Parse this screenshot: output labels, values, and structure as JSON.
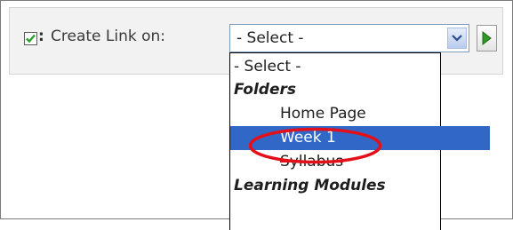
{
  "toolbar": {
    "checkbox_icon": "checkbox-checked-icon",
    "colon": ":",
    "label": "Create Link on:",
    "select_value": "- Select -",
    "arrow_icon": "chevron-down-icon",
    "go_icon": "play-arrow-icon"
  },
  "dropdown": {
    "options": [
      {
        "label": "- Select -",
        "kind": "option"
      },
      {
        "label": "Folders",
        "kind": "group"
      },
      {
        "label": "Home Page",
        "kind": "option"
      },
      {
        "label": "Week 1",
        "kind": "option",
        "selected": true
      },
      {
        "label": "Syllabus",
        "kind": "option"
      },
      {
        "label": "Learning Modules",
        "kind": "group"
      }
    ]
  },
  "annotation": {
    "shape": "ellipse",
    "color": "#e3101a",
    "target": "Week 1"
  },
  "colors": {
    "selection": "#3167c7",
    "toolbar_background": "#f2f2f2",
    "check_green": "#27a32a"
  }
}
